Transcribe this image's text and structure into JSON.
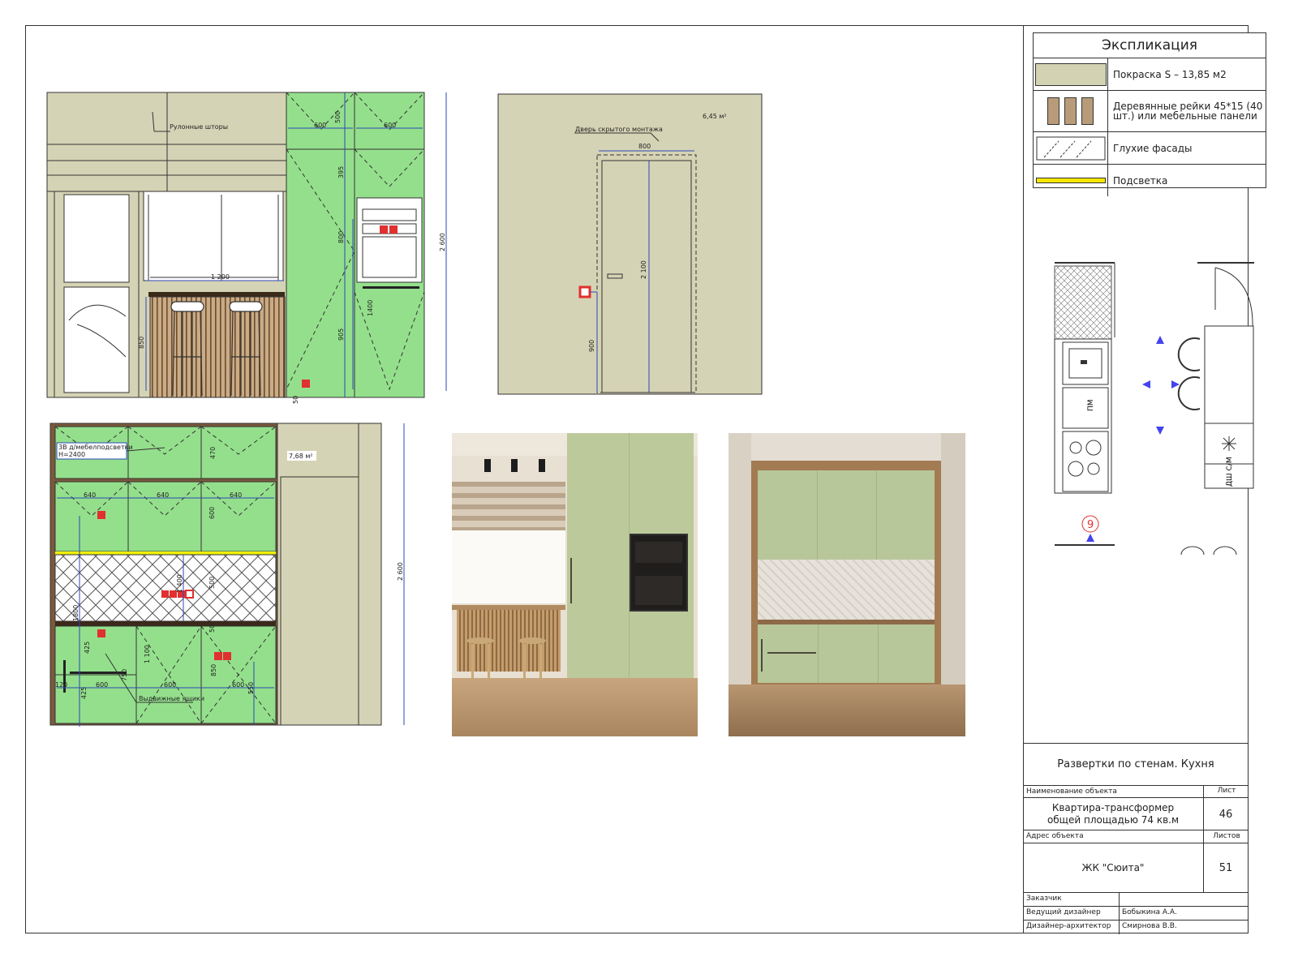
{
  "legend": {
    "title": "Экспликация",
    "items": [
      {
        "label": "Покраска S – 13,85 м2",
        "swatch": "paint",
        "color": "#d3d2b3"
      },
      {
        "label": "Деревянные рейки 45*15 (40 шт.) или мебельные панели",
        "swatch": "wood",
        "color": "#b89c79"
      },
      {
        "label": "Глухие фасады",
        "swatch": "hatch",
        "color": "#ffffff"
      },
      {
        "label": "Подсветка",
        "swatch": "light",
        "color": "#f5e600"
      }
    ]
  },
  "colors": {
    "wall": "#d5d3b5",
    "facade_green": "#94df8c",
    "wood": "#7a5a3b",
    "dim_line": "#2a48b5",
    "socket": "#e0302f",
    "backlight": "#f2ef0b"
  },
  "elevation1": {
    "blind_label": "Рулонные шторы",
    "dims": {
      "d600a": "600",
      "d500": "500",
      "d600b": "600",
      "d395": "395",
      "d800": "800",
      "d1400": "1400",
      "d905": "905",
      "d2600": "2 600",
      "d1200": "1 200",
      "d850": "850",
      "d50": "50"
    }
  },
  "elevation2": {
    "door_label": "Дверь скрытого монтажа",
    "area": "6,45 м²",
    "dims": {
      "d800": "800",
      "d2100": "2 100",
      "d900": "900"
    }
  },
  "elevation3": {
    "note_line1": "3В д/мебелподсветки",
    "note_line2": "Н=2400",
    "area": "7,68 м²",
    "drawers_label": "Выдвижные ящики",
    "dims": {
      "d470": "470",
      "d640a": "640",
      "d640b": "640",
      "d640c": "640",
      "d600": "600",
      "d500": "500",
      "d1400": "1 400",
      "d1800": "1800",
      "d50": "50",
      "d425a": "425",
      "d425b": "425",
      "d750": "750",
      "d1100": "1 100",
      "d120": "120",
      "d600a": "600",
      "d600b": "600",
      "d600c": "600",
      "d850": "850",
      "d550": "550",
      "d2600": "2 600"
    }
  },
  "plan": {
    "marker": "9",
    "pm_label": "ПМ",
    "fridge_label": "ДШ С/М"
  },
  "title_block": {
    "sheet_title": "Развертки по стенам. Кухня",
    "object_label": "Наименование объекта",
    "sheet_label": "Лист",
    "object_name_line1": "Квартира-трансформер",
    "object_name_line2": "общей площадью 74 кв.м",
    "sheet_number": "46",
    "address_label": "Адрес объекта",
    "sheets_label": "Листов",
    "address": "ЖК \"Сюита\"",
    "sheets_total": "51",
    "customer_label": "Заказчик",
    "lead_label": "Ведущий дизайнер",
    "lead_name": "Бобыкина А.А.",
    "architect_label": "Дизайнер-архитектор",
    "architect_name": "Смирнова В.В."
  }
}
